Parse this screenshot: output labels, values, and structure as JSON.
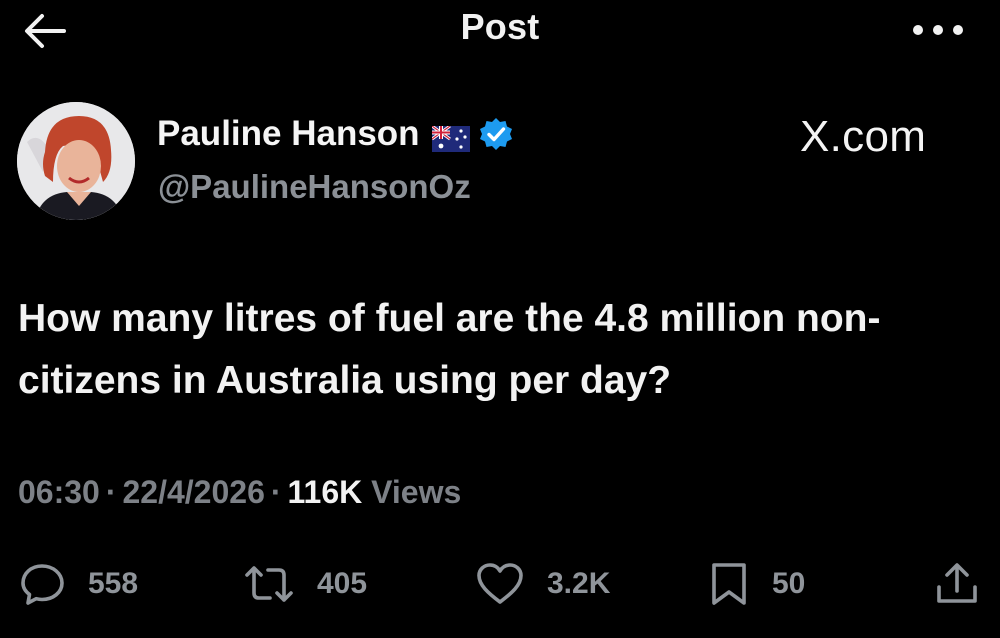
{
  "header": {
    "title": "Post",
    "back_icon": "arrow-left-icon",
    "more_icon": "more-horizontal-icon"
  },
  "author": {
    "name": "Pauline Hanson",
    "handle": "@PaulineHansonOz",
    "flag_icon": "australian-flag-icon",
    "verified_icon": "verified-badge-icon",
    "verified_color": "#1d9bf0"
  },
  "watermark": "X.com",
  "post": {
    "text": "How many litres of fuel are the 4.8 million non-citizens in Australia using per day?"
  },
  "meta": {
    "time": "06:30",
    "separator": "·",
    "date": "22/4/2026",
    "views_count": "116K",
    "views_label": "Views"
  },
  "actions": {
    "replies": "558",
    "reposts": "405",
    "likes": "3.2K",
    "bookmarks": "50"
  },
  "colors": {
    "background": "#000000",
    "primary_text": "#f2f2f2",
    "secondary_text": "#7d8187"
  }
}
